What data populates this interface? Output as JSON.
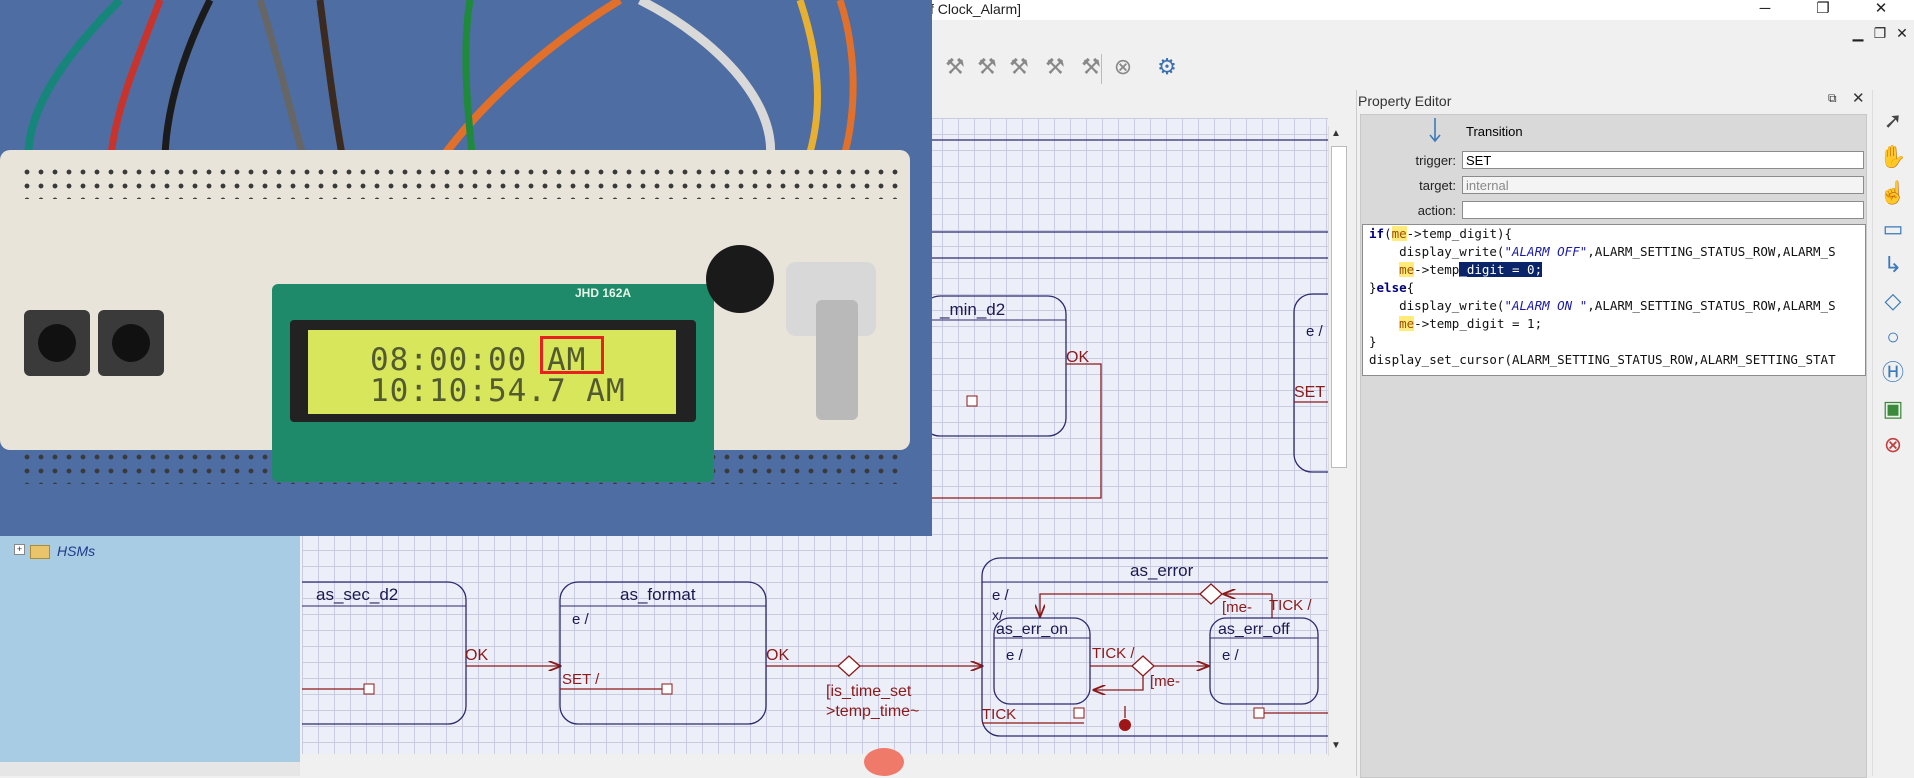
{
  "window": {
    "title": "f Clock_Alarm]",
    "minimize": "─",
    "maximize": "❐",
    "close": "✕",
    "mdi_minimize": "▁",
    "mdi_restore": "❐",
    "mdi_close": "✕"
  },
  "toolbar": {
    "items": [
      "build-hammer-icon",
      "build-hammer-icon",
      "build-hammer-icon",
      "build-hammer-icon",
      "build-hammer-icon",
      "stop-icon",
      "build-settings-icon"
    ]
  },
  "tree": {
    "expander": "+",
    "item_label": "HSMs"
  },
  "video": {
    "lcd_line1": "08:00:00 AM",
    "lcd_line2": "10:10:54.7 AM",
    "pcb_marking": "JHD 162A",
    "highlight_color": "#e82020"
  },
  "diagram": {
    "states": {
      "as_min_d2": "_min_d2",
      "as_sec_d2": "as_sec_d2",
      "as_format": "as_format",
      "as_error": "as_error",
      "as_err_on": "as_err_on",
      "as_err_off": "as_err_off",
      "right_partial_entry": "e /",
      "as_format_entry": "e /",
      "as_error_entry": "e /",
      "as_error_exit": "x/",
      "as_err_on_entry": "e /",
      "as_err_off_entry": "e /"
    },
    "transitions": {
      "ok_min_d2": "OK",
      "set_right": "SET",
      "ok_sec_d2": "OK",
      "slash_left": "/",
      "set_format": "SET /",
      "ok_format": "OK",
      "guard_time_set": "[is_time_set",
      "guard_time_set_2": ">temp_time~",
      "guard_me_1": "[me-",
      "tick_1": "TICK /",
      "tick_2": "TICK /",
      "guard_me_2": "[me-",
      "tick_3": "TICK"
    },
    "colors": {
      "state_border": "#2b2b6e",
      "transition": "#8b1a1a",
      "canvas": "#eceef8"
    }
  },
  "property_editor": {
    "title": "Property Editor",
    "float": "⧉",
    "close": "✕",
    "element_type": "Transition",
    "trigger_label": "trigger:",
    "trigger_value": "SET",
    "target_label": "target:",
    "target_value": "internal",
    "action_label": "action:",
    "action_value": "",
    "code": {
      "l1_kw": "if",
      "l1_a": "(",
      "l1_me": "me",
      "l1_b": "->temp_digit){",
      "l2_a": "    display_write(",
      "l2_str": "\"ALARM OFF\"",
      "l2_b": ",ALARM_SETTING_STATUS_ROW,ALARM_S",
      "l3_a": "    ",
      "l3_me": "me",
      "l3_b": "->temp",
      "l3_sel": "_digit = 0;",
      "l4_a": "}",
      "l4_kw": "else",
      "l4_b": "{",
      "l5_a": "    display_write(",
      "l5_str": "\"ALARM ON \"",
      "l5_b": ",ALARM_SETTING_STATUS_ROW,ALARM_S",
      "l6_a": "    ",
      "l6_me": "me",
      "l6_b": "->temp_digit = 1;",
      "l7": "}",
      "l8": "display_set_cursor(ALARM_SETTING_STATUS_ROW,ALARM_SETTING_STAT"
    }
  },
  "palette": {
    "items": [
      "select-arrow-icon",
      "pan-hand-icon",
      "hand-cursor-icon",
      "state-icon",
      "transition-icon",
      "choice-icon",
      "initial-icon",
      "history-icon",
      "submachine-icon",
      "final-icon"
    ]
  }
}
